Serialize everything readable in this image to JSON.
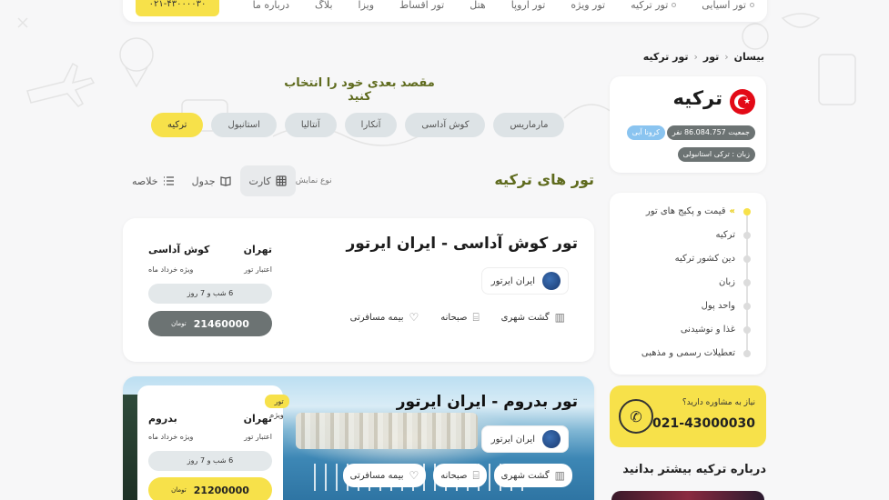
{
  "topnav": {
    "items": [
      "تور آسیایی",
      "تور ترکیه",
      "تور ویژه",
      "تور اروپا",
      "هتل",
      "تور اقساط",
      "ویزا",
      "بلاگ",
      "درباره ما"
    ],
    "phone": "۰۲۱-۴۳۰۰۰۰۳۰"
  },
  "breadcrumb": [
    "بیسان",
    "تور",
    "تور ترکیه"
  ],
  "country": {
    "name": "ترکیه",
    "population": "جمعیت 86.084.757 نفر",
    "corona": "کرونا آبی",
    "language": "زبان : ترکی استانبولی"
  },
  "destinations": {
    "title": "مقصد بعدی خود را انتخاب کنید",
    "chips": [
      "ترکیه",
      "استانبول",
      "آنتالیا",
      "آنکارا",
      "کوش آداسی",
      "مارماریس"
    ],
    "active_index": 0
  },
  "tours": {
    "title": "تور های ترکیه",
    "view_label": "نوع نمایش",
    "views": [
      "کارت",
      "جدول",
      "خلاصه"
    ],
    "active_view": 0,
    "cards": [
      {
        "title": "تور کوش آداسی - ایران ایرتور",
        "airline": "ایران ایرتور",
        "features": [
          "گشت شهری",
          "صبحانه",
          "بیمه مسافرتی"
        ],
        "origin": "تهران",
        "destination": "کوش آداسی",
        "validity_label": "اعتبار تور",
        "validity": "ویژه خرداد ماه",
        "duration": "6 شب و 7 روز",
        "price": "21460000",
        "currency": "تومان"
      },
      {
        "title": "تور بدروم - ایران ایرتور",
        "airline": "ایران ایرتور",
        "features": [
          "گشت شهری",
          "صبحانه",
          "بیمه مسافرتی"
        ],
        "tag": "تور ویژه",
        "origin": "تهران",
        "destination": "بدروم",
        "validity_label": "اعتبار تور",
        "validity": "ویژه خرداد ماه",
        "duration": "6 شب و 7 روز",
        "price": "21200000",
        "currency": "تومان"
      }
    ]
  },
  "sidebar_nav": {
    "items": [
      "قیمت و پکیج های تور",
      "ترکیه",
      "دین کشور ترکیه",
      "زبان",
      "واحد پول",
      "غذا و نوشیدنی",
      "تعطیلات رسمی و مذهبی"
    ],
    "active_index": 0
  },
  "consult": {
    "question": "نیاز به مشاوره دارید؟",
    "phone": "021-43000030"
  },
  "more_title": "درباره ترکیه بیشتر بدانید",
  "colors": {
    "accent": "#f7e14a",
    "heading": "#5f6b1e",
    "muted_badge": "#6c7373",
    "corona": "#8ac4f0"
  }
}
